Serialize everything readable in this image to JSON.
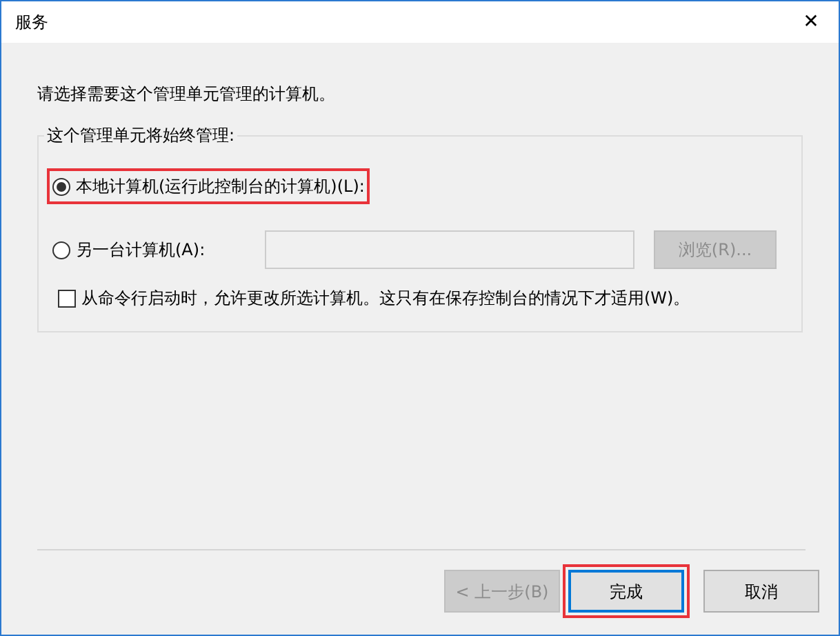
{
  "window": {
    "title": "服务",
    "close": "✕"
  },
  "prompt": "请选择需要这个管理单元管理的计算机。",
  "group": {
    "title": "这个管理单元将始终管理:",
    "options": [
      {
        "label": "本地计算机(运行此控制台的计算机)(L):",
        "selected": true,
        "highlighted": true
      },
      {
        "label": "另一台计算机(A):",
        "selected": false,
        "highlighted": false
      }
    ],
    "browse": {
      "label": "浏览(R)...",
      "disabled": true
    },
    "checkbox": {
      "label": "从命令行启动时，允许更改所选计算机。这只有在保存控制台的情况下才适用(W)。",
      "checked": false
    }
  },
  "buttons": [
    {
      "label": "< 上一步(B)",
      "disabled": true,
      "default": false,
      "highlighted": false
    },
    {
      "label": "完成",
      "disabled": false,
      "default": true,
      "highlighted": true
    },
    {
      "label": "取消",
      "disabled": false,
      "default": false,
      "highlighted": false
    }
  ]
}
